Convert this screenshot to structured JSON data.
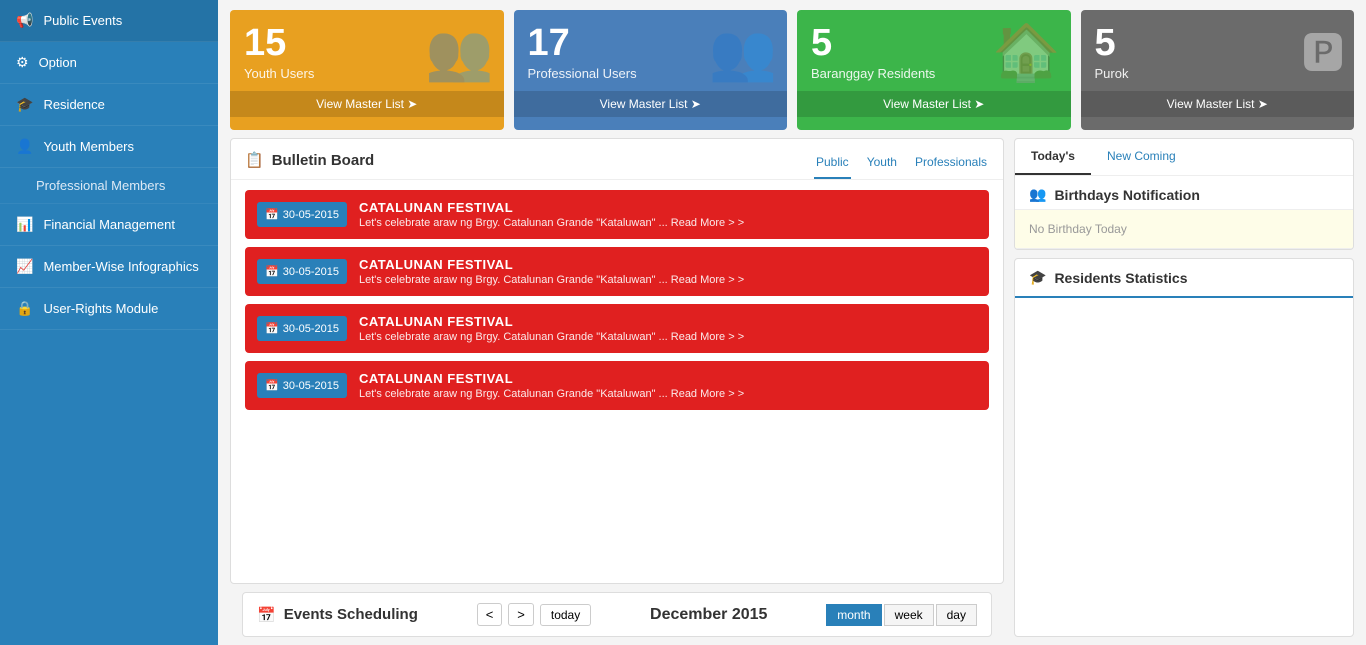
{
  "sidebar": {
    "items": [
      {
        "id": "public-events",
        "label": "Public Events",
        "icon": "📢",
        "active": false
      },
      {
        "id": "option",
        "label": "Option",
        "icon": "⚙",
        "active": false
      },
      {
        "id": "residence",
        "label": "Residence",
        "icon": "🎓",
        "active": false
      },
      {
        "id": "youth-members",
        "label": "Youth Members",
        "icon": "👤",
        "active": false
      },
      {
        "id": "professional-members",
        "label": "Professional Members",
        "icon": "",
        "sub": true,
        "active": false
      },
      {
        "id": "financial-management",
        "label": "Financial Management",
        "icon": "📊",
        "active": false
      },
      {
        "id": "member-wise-infographics",
        "label": "Member-Wise Infographics",
        "icon": "📈",
        "active": false
      },
      {
        "id": "user-rights-module",
        "label": "User-Rights Module",
        "icon": "🔒",
        "active": false
      }
    ]
  },
  "stats": [
    {
      "id": "youth-users",
      "number": "15",
      "label": "Youth Users",
      "link": "View Master List",
      "color": "orange",
      "icon": "👥"
    },
    {
      "id": "professional-users",
      "number": "17",
      "label": "Professional Users",
      "link": "View Master List",
      "color": "blue",
      "icon": "👥"
    },
    {
      "id": "baranggay-residents",
      "number": "5",
      "label": "Baranggay Residents",
      "link": "View Master List",
      "color": "green",
      "icon": "🏠"
    },
    {
      "id": "purok",
      "number": "5",
      "label": "Purok",
      "link": "View Master List",
      "color": "gray",
      "icon": "🅿"
    }
  ],
  "bulletin": {
    "title": "Bulletin Board",
    "tabs": [
      {
        "id": "public",
        "label": "Public"
      },
      {
        "id": "youth",
        "label": "Youth"
      },
      {
        "id": "professionals",
        "label": "Professionals"
      }
    ],
    "active_tab": "public",
    "events": [
      {
        "date": "30-05-2015",
        "title": "CATALUNAN FESTIVAL",
        "desc": "Let's celebrate araw ng Brgy. Catalunan Grande \"Kataluwan\" ... Read More > >"
      },
      {
        "date": "30-05-2015",
        "title": "CATALUNAN FESTIVAL",
        "desc": "Let's celebrate araw ng Brgy. Catalunan Grande \"Kataluwan\" ... Read More > >"
      },
      {
        "date": "30-05-2015",
        "title": "CATALUNAN FESTIVAL",
        "desc": "Let's celebrate araw ng Brgy. Catalunan Grande \"Kataluwan\" ... Read More > >"
      },
      {
        "date": "30-05-2015",
        "title": "CATALUNAN FESTIVAL",
        "desc": "Let's celebrate araw ng Brgy. Catalunan Grande \"Kataluwan\" ... Read More > >"
      }
    ]
  },
  "events_scheduling": {
    "title": "Events Scheduling",
    "month_label": "December 2015",
    "nav": {
      "prev": "<",
      "next": ">",
      "today": "today"
    },
    "view_buttons": [
      {
        "id": "month",
        "label": "month",
        "active": true
      },
      {
        "id": "week",
        "label": "week",
        "active": false
      },
      {
        "id": "day",
        "label": "day",
        "active": false
      }
    ]
  },
  "birthdays": {
    "title": "Birthdays Notification",
    "tabs": [
      {
        "id": "todays",
        "label": "Today's",
        "active": true
      },
      {
        "id": "new-coming",
        "label": "New Coming",
        "active": false
      }
    ],
    "no_birthday_text": "No Birthday Today"
  },
  "residents_statistics": {
    "title": "Residents Statistics"
  }
}
